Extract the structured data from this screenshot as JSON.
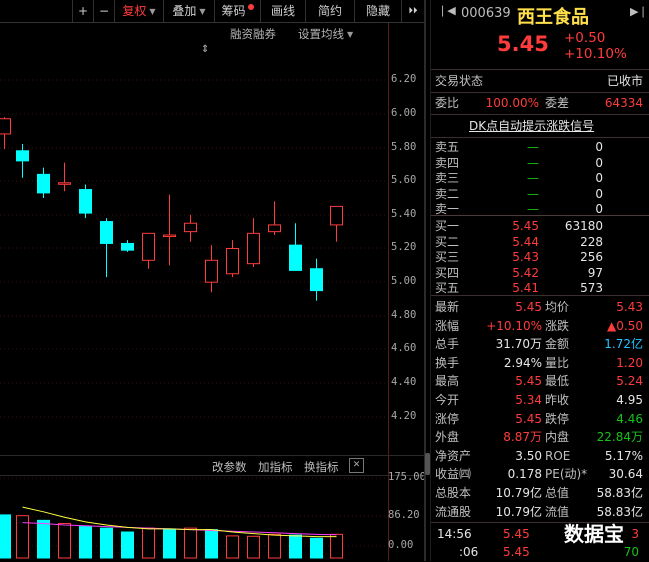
{
  "toolbar": {
    "plus": "+",
    "minus": "−",
    "restore_label": "复权",
    "overlay_label": "叠加",
    "chips_label": "筹码",
    "draw_label": "画线",
    "browse_label": "简约",
    "hide_label": "隐藏",
    "expand_symbol": "⏵⏵",
    "close_symbol": "✕"
  },
  "chart_links": {
    "margin": "融资融券",
    "ma_setting": "设置均线"
  },
  "chart_data": {
    "type": "candlestick",
    "price_ticks": [
      "6.20",
      "6.00",
      "5.80",
      "5.60",
      "5.40",
      "5.20",
      "5.00",
      "4.80",
      "4.60",
      "4.40",
      "4.20"
    ],
    "ylim": [
      4.12,
      6.28
    ],
    "candles": [
      {
        "o": 5.88,
        "h": 5.98,
        "l": 5.79,
        "c": 5.97
      },
      {
        "o": 5.78,
        "h": 5.82,
        "l": 5.62,
        "c": 5.72
      },
      {
        "o": 5.64,
        "h": 5.68,
        "l": 5.5,
        "c": 5.53
      },
      {
        "o": 5.59,
        "h": 5.71,
        "l": 5.54,
        "c": 5.59
      },
      {
        "o": 5.55,
        "h": 5.58,
        "l": 5.38,
        "c": 5.41
      },
      {
        "o": 5.36,
        "h": 5.38,
        "l": 5.03,
        "c": 5.23
      },
      {
        "o": 5.23,
        "h": 5.25,
        "l": 5.18,
        "c": 5.19
      },
      {
        "o": 5.13,
        "h": 5.28,
        "l": 5.08,
        "c": 5.29
      },
      {
        "o": 5.28,
        "h": 5.52,
        "l": 5.1,
        "c": 5.28
      },
      {
        "o": 5.3,
        "h": 5.4,
        "l": 5.24,
        "c": 5.35
      },
      {
        "o": 5.0,
        "h": 5.22,
        "l": 4.94,
        "c": 5.13
      },
      {
        "o": 5.05,
        "h": 5.25,
        "l": 5.03,
        "c": 5.2
      },
      {
        "o": 5.11,
        "h": 5.38,
        "l": 5.09,
        "c": 5.29
      },
      {
        "o": 5.3,
        "h": 5.48,
        "l": 5.28,
        "c": 5.34
      },
      {
        "o": 5.22,
        "h": 5.35,
        "l": 5.07,
        "c": 5.07
      },
      {
        "o": 5.08,
        "h": 5.14,
        "l": 4.89,
        "c": 4.95
      },
      {
        "o": 5.34,
        "h": 5.45,
        "l": 5.24,
        "c": 5.45
      }
    ]
  },
  "volume_panel": {
    "links": [
      "改参数",
      "加指标",
      "换指标"
    ],
    "close": "✕",
    "ticks": [
      "175.00",
      "86.20",
      "0.00"
    ],
    "ylim": [
      0,
      175
    ],
    "bars": [
      {
        "v": 80,
        "up": false
      },
      {
        "v": 78,
        "up": true
      },
      {
        "v": 66,
        "up": false
      },
      {
        "v": 58,
        "up": true
      },
      {
        "v": 50,
        "up": false
      },
      {
        "v": 46,
        "up": false
      },
      {
        "v": 36,
        "up": false
      },
      {
        "v": 46,
        "up": true
      },
      {
        "v": 44,
        "up": false
      },
      {
        "v": 46,
        "up": true
      },
      {
        "v": 42,
        "up": false
      },
      {
        "v": 26,
        "up": true
      },
      {
        "v": 25,
        "up": true
      },
      {
        "v": 30,
        "up": true
      },
      {
        "v": 28,
        "up": false
      },
      {
        "v": 20,
        "up": false
      },
      {
        "v": 30,
        "up": true
      }
    ],
    "ma5": [
      null,
      100,
      88,
      74,
      62,
      54,
      48,
      44,
      44,
      42,
      42,
      36,
      32,
      28,
      26,
      24,
      24
    ],
    "ma10": [
      null,
      60,
      58,
      54,
      52,
      50,
      48,
      46,
      44,
      42,
      40,
      38,
      36,
      34,
      32,
      30,
      29
    ]
  },
  "stock": {
    "code": "000639",
    "name": "西王食品",
    "price": "5.45",
    "change": "+0.50",
    "change_pct": "+10.10%"
  },
  "status": {
    "label": "交易状态",
    "value": "已收市"
  },
  "order_ratio": {
    "wb_label": "委比",
    "wb_value": "100.00%",
    "wc_label": "委差",
    "wc_value": "64334"
  },
  "signal_link": "DK点自动提示涨跌信号",
  "sell_orders": [
    {
      "label": "卖五",
      "price": "—",
      "volume": "0"
    },
    {
      "label": "卖四",
      "price": "—",
      "volume": "0"
    },
    {
      "label": "卖三",
      "price": "—",
      "volume": "0"
    },
    {
      "label": "卖二",
      "price": "—",
      "volume": "0"
    },
    {
      "label": "卖一",
      "price": "—",
      "volume": "0"
    }
  ],
  "buy_orders": [
    {
      "label": "买一",
      "price": "5.45",
      "volume": "63180"
    },
    {
      "label": "买二",
      "price": "5.44",
      "volume": "228"
    },
    {
      "label": "买三",
      "price": "5.43",
      "volume": "256"
    },
    {
      "label": "买四",
      "price": "5.42",
      "volume": "97"
    },
    {
      "label": "买五",
      "price": "5.41",
      "volume": "573"
    }
  ],
  "stats": [
    {
      "l1": "最新",
      "v1": "5.45",
      "c1": "red",
      "l2": "均价",
      "v2": "5.43",
      "c2": "red"
    },
    {
      "l1": "涨幅",
      "v1": "+10.10%",
      "c1": "red",
      "l2": "涨跌",
      "v2": "▲0.50",
      "c2": "red"
    },
    {
      "l1": "总手",
      "v1": "31.70万",
      "c1": "white",
      "l2": "金额",
      "v2": "1.72亿",
      "c2": "cyan"
    },
    {
      "l1": "换手",
      "v1": "2.94%",
      "c1": "white",
      "l2": "量比",
      "v2": "1.20",
      "c2": "red"
    },
    {
      "l1": "最高",
      "v1": "5.45",
      "c1": "red",
      "l2": "最低",
      "v2": "5.24",
      "c2": "red"
    },
    {
      "l1": "今开",
      "v1": "5.34",
      "c1": "red",
      "l2": "昨收",
      "v2": "4.95",
      "c2": "white"
    },
    {
      "l1": "涨停",
      "v1": "5.45",
      "c1": "red",
      "l2": "跌停",
      "v2": "4.46",
      "c2": "green"
    },
    {
      "l1": "外盘",
      "v1": "8.87万",
      "c1": "red",
      "l2": "内盘",
      "v2": "22.84万",
      "c2": "green"
    },
    {
      "l1": "净资产",
      "v1": "3.50",
      "c1": "white",
      "l2": "ROE",
      "v2": "5.17%",
      "c2": "white"
    },
    {
      "l1": "收益㈣",
      "v1": "0.178",
      "c1": "white",
      "l2": "PE(动)*",
      "v2": "30.64",
      "c2": "white"
    },
    {
      "l1": "总股本",
      "v1": "10.79亿",
      "c1": "white",
      "l2": "总值",
      "v2": "58.83亿",
      "c2": "white"
    },
    {
      "l1": "流通股",
      "v1": "10.79亿",
      "c1": "white",
      "l2": "流值",
      "v2": "58.83亿",
      "c2": "white"
    }
  ],
  "ticks_list": [
    {
      "time": "14:56",
      "price": "5.45",
      "volume": "3"
    },
    {
      "time": ":06",
      "price": "5.45",
      "volume": "70"
    }
  ],
  "watermark": "数据宝",
  "colors": {
    "up": "#ff3c3c",
    "down": "#00ffff",
    "ma5": "#ffff3c",
    "ma10": "#ff3cff",
    "bg": "#000000"
  }
}
